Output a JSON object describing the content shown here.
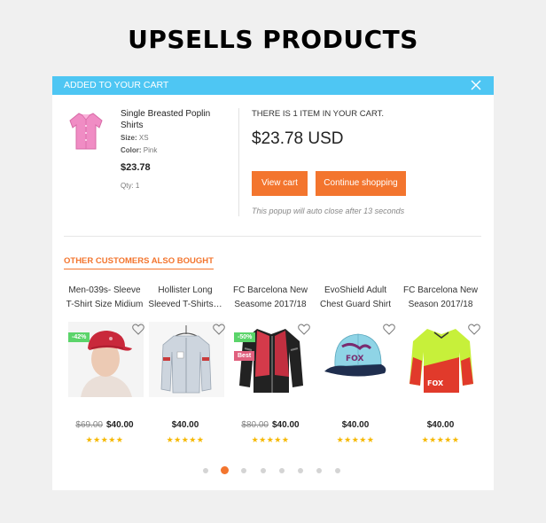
{
  "page": {
    "heading": "UPSELLS PRODUCTS"
  },
  "popup": {
    "header_title": "ADDED TO YOUR CART",
    "close_icon": "close-icon",
    "product": {
      "name": "Single Breasted Poplin Shirts",
      "size_label": "Size:",
      "size_value": "XS",
      "color_label": "Color:",
      "color_value": "Pink",
      "price": "$23.78",
      "qty": "Qty: 1",
      "image": "pink-shirt"
    },
    "cart": {
      "count_text": "THERE IS 1 ITEM IN YOUR CART.",
      "total": "$23.78 USD",
      "view_cart_label": "View cart",
      "continue_label": "Continue shopping",
      "autoclose_text": "This popup will auto close after 13 seconds"
    }
  },
  "also_bought": {
    "title": "OTHER CUSTOMERS ALSO BOUGHT",
    "items": [
      {
        "title": "Men-039s- Sleeve T-Shirt Size Midium",
        "old_price": "$69.00",
        "price": "$40.00",
        "badge": "-42%",
        "badge2": "",
        "rating": 5,
        "image": "red-cap-model"
      },
      {
        "title": "Hollister Long Sleeved T-Shirts…",
        "old_price": "",
        "price": "$40.00",
        "badge": "",
        "badge2": "",
        "rating": 5,
        "image": "grey-jacket"
      },
      {
        "title": "FC Barcelona New Seasome 2017/18",
        "old_price": "$80.00",
        "price": "$40.00",
        "badge": "-50%",
        "badge2": "Best",
        "rating": 5,
        "image": "moto-jacket"
      },
      {
        "title": "EvoShield Adult Chest Guard Shirt",
        "old_price": "",
        "price": "$40.00",
        "badge": "",
        "badge2": "",
        "rating": 5,
        "image": "fox-cap"
      },
      {
        "title": "FC Barcelona New Season 2017/18",
        "old_price": "",
        "price": "$40.00",
        "badge": "",
        "badge2": "",
        "rating": 5,
        "image": "motocross-jersey"
      }
    ],
    "stars_text": "★★★★★"
  },
  "pagination": {
    "count": 8,
    "active": 1
  },
  "colors": {
    "accent": "#f3752e",
    "header": "#4ec6f3",
    "star": "#f6b800"
  }
}
